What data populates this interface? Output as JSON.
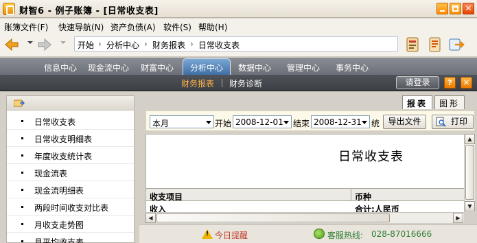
{
  "window": {
    "title": "财智6 - 例子账簿 - [日常收支表]",
    "buttons": {
      "minimize": "",
      "maximize": "",
      "close": "✕"
    }
  },
  "menu": [
    {
      "label": "账簿文件(F)"
    },
    {
      "label": "快速导航(N)"
    },
    {
      "label": "资产负债(A)"
    },
    {
      "label": "软件(S)"
    },
    {
      "label": "帮助(H)"
    }
  ],
  "breadcrumb": [
    "开始",
    "分析中心",
    "财务报表",
    "日常收支表"
  ],
  "breadcrumb_separator": "›",
  "toolbar_icons": [
    "book-icon",
    "notebook-icon",
    "export-icon"
  ],
  "main_tabs": [
    {
      "label": "信息中心"
    },
    {
      "label": "现金流中心"
    },
    {
      "label": "财富中心"
    },
    {
      "label": "分析中心",
      "active": true
    },
    {
      "label": "数据中心"
    },
    {
      "label": "管理中心"
    },
    {
      "label": "事务中心"
    }
  ],
  "sub_tabs": [
    {
      "label": "财务报表",
      "active": true
    },
    {
      "label": "财务诊断"
    }
  ],
  "login_label": "请登录",
  "help_label": "?",
  "close_label": "✕",
  "nav_items": [
    {
      "label": "日常收支表"
    },
    {
      "label": "日常收支明细表"
    },
    {
      "label": "年度收支统计表"
    },
    {
      "label": "现金流表"
    },
    {
      "label": "现金流明细表"
    },
    {
      "label": "两段时间收支对比表"
    },
    {
      "label": "月收支走势图"
    },
    {
      "label": "月平均收支表"
    }
  ],
  "report_tabs": [
    {
      "label": "报表",
      "active": true
    },
    {
      "label": "图形"
    }
  ],
  "filter": {
    "period": "本月",
    "start_label": "开始",
    "start_date": "2008-12-01",
    "end_label": "结束",
    "end_date": "2008-12-31",
    "trailing_label": "统",
    "export_label": "导出文件",
    "print_label": "打印"
  },
  "report": {
    "title": "日常收支表",
    "columns": [
      "收支项目",
      "币种"
    ],
    "rows": [
      [
        "收入",
        "合计:人民币"
      ]
    ]
  },
  "status": {
    "reminder": "今日提醒",
    "hotline_label": "客服热线:",
    "hotline_number": "028-87016666"
  },
  "colors": {
    "active_tab": "#3f6ea4",
    "active_subtab": "#ffb347",
    "window_button": "#ff8c00"
  }
}
